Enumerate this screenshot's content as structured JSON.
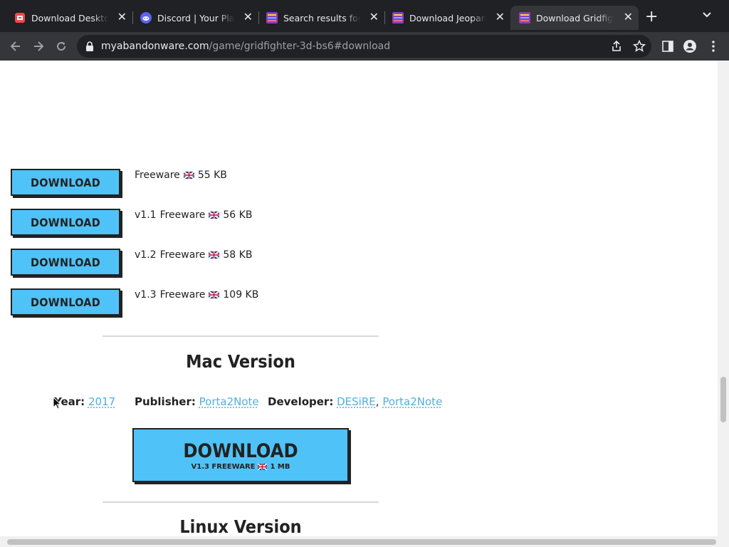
{
  "browser": {
    "tabs": [
      {
        "title": "Download Desktop",
        "icon": "download-app-favicon",
        "active": false
      },
      {
        "title": "Discord | Your Place",
        "icon": "discord-favicon",
        "active": false
      },
      {
        "title": "Search results for",
        "icon": "myabandonware-favicon",
        "active": false
      },
      {
        "title": "Download Jeopardy",
        "icon": "myabandonware-favicon",
        "active": false
      },
      {
        "title": "Download Gridfighter",
        "icon": "myabandonware-favicon",
        "active": true
      }
    ],
    "new_tab_icon": "plus-icon",
    "url_domain": "myabandonware.com",
    "url_path": "/game/gridfighter-3d-bs6#download"
  },
  "downloads": [
    {
      "button": "DOWNLOAD",
      "version": "",
      "license": "Freeware",
      "size": "55 KB"
    },
    {
      "button": "DOWNLOAD",
      "version": "v1.1",
      "license": "Freeware",
      "size": "56 KB"
    },
    {
      "button": "DOWNLOAD",
      "version": "v1.2",
      "license": "Freeware",
      "size": "58 KB"
    },
    {
      "button": "DOWNLOAD",
      "version": "v1.3",
      "license": "Freeware",
      "size": "109 KB"
    }
  ],
  "mac": {
    "title": "Mac Version",
    "year_label": "Year:",
    "year": "2017",
    "publisher_label": "Publisher:",
    "publisher": "Porta2Note",
    "developer_label": "Developer:",
    "developers": [
      "DESiRE",
      "Porta2Note"
    ],
    "separator": ",",
    "download_main": "DOWNLOAD",
    "download_sub_version": "V1.3 FREEWARE",
    "download_sub_size": "1 MB"
  },
  "linux": {
    "title": "Linux Version"
  },
  "colors": {
    "button_blue": "#4fc3f7",
    "link_blue": "#4fb0db",
    "chrome_dark": "#202124"
  }
}
